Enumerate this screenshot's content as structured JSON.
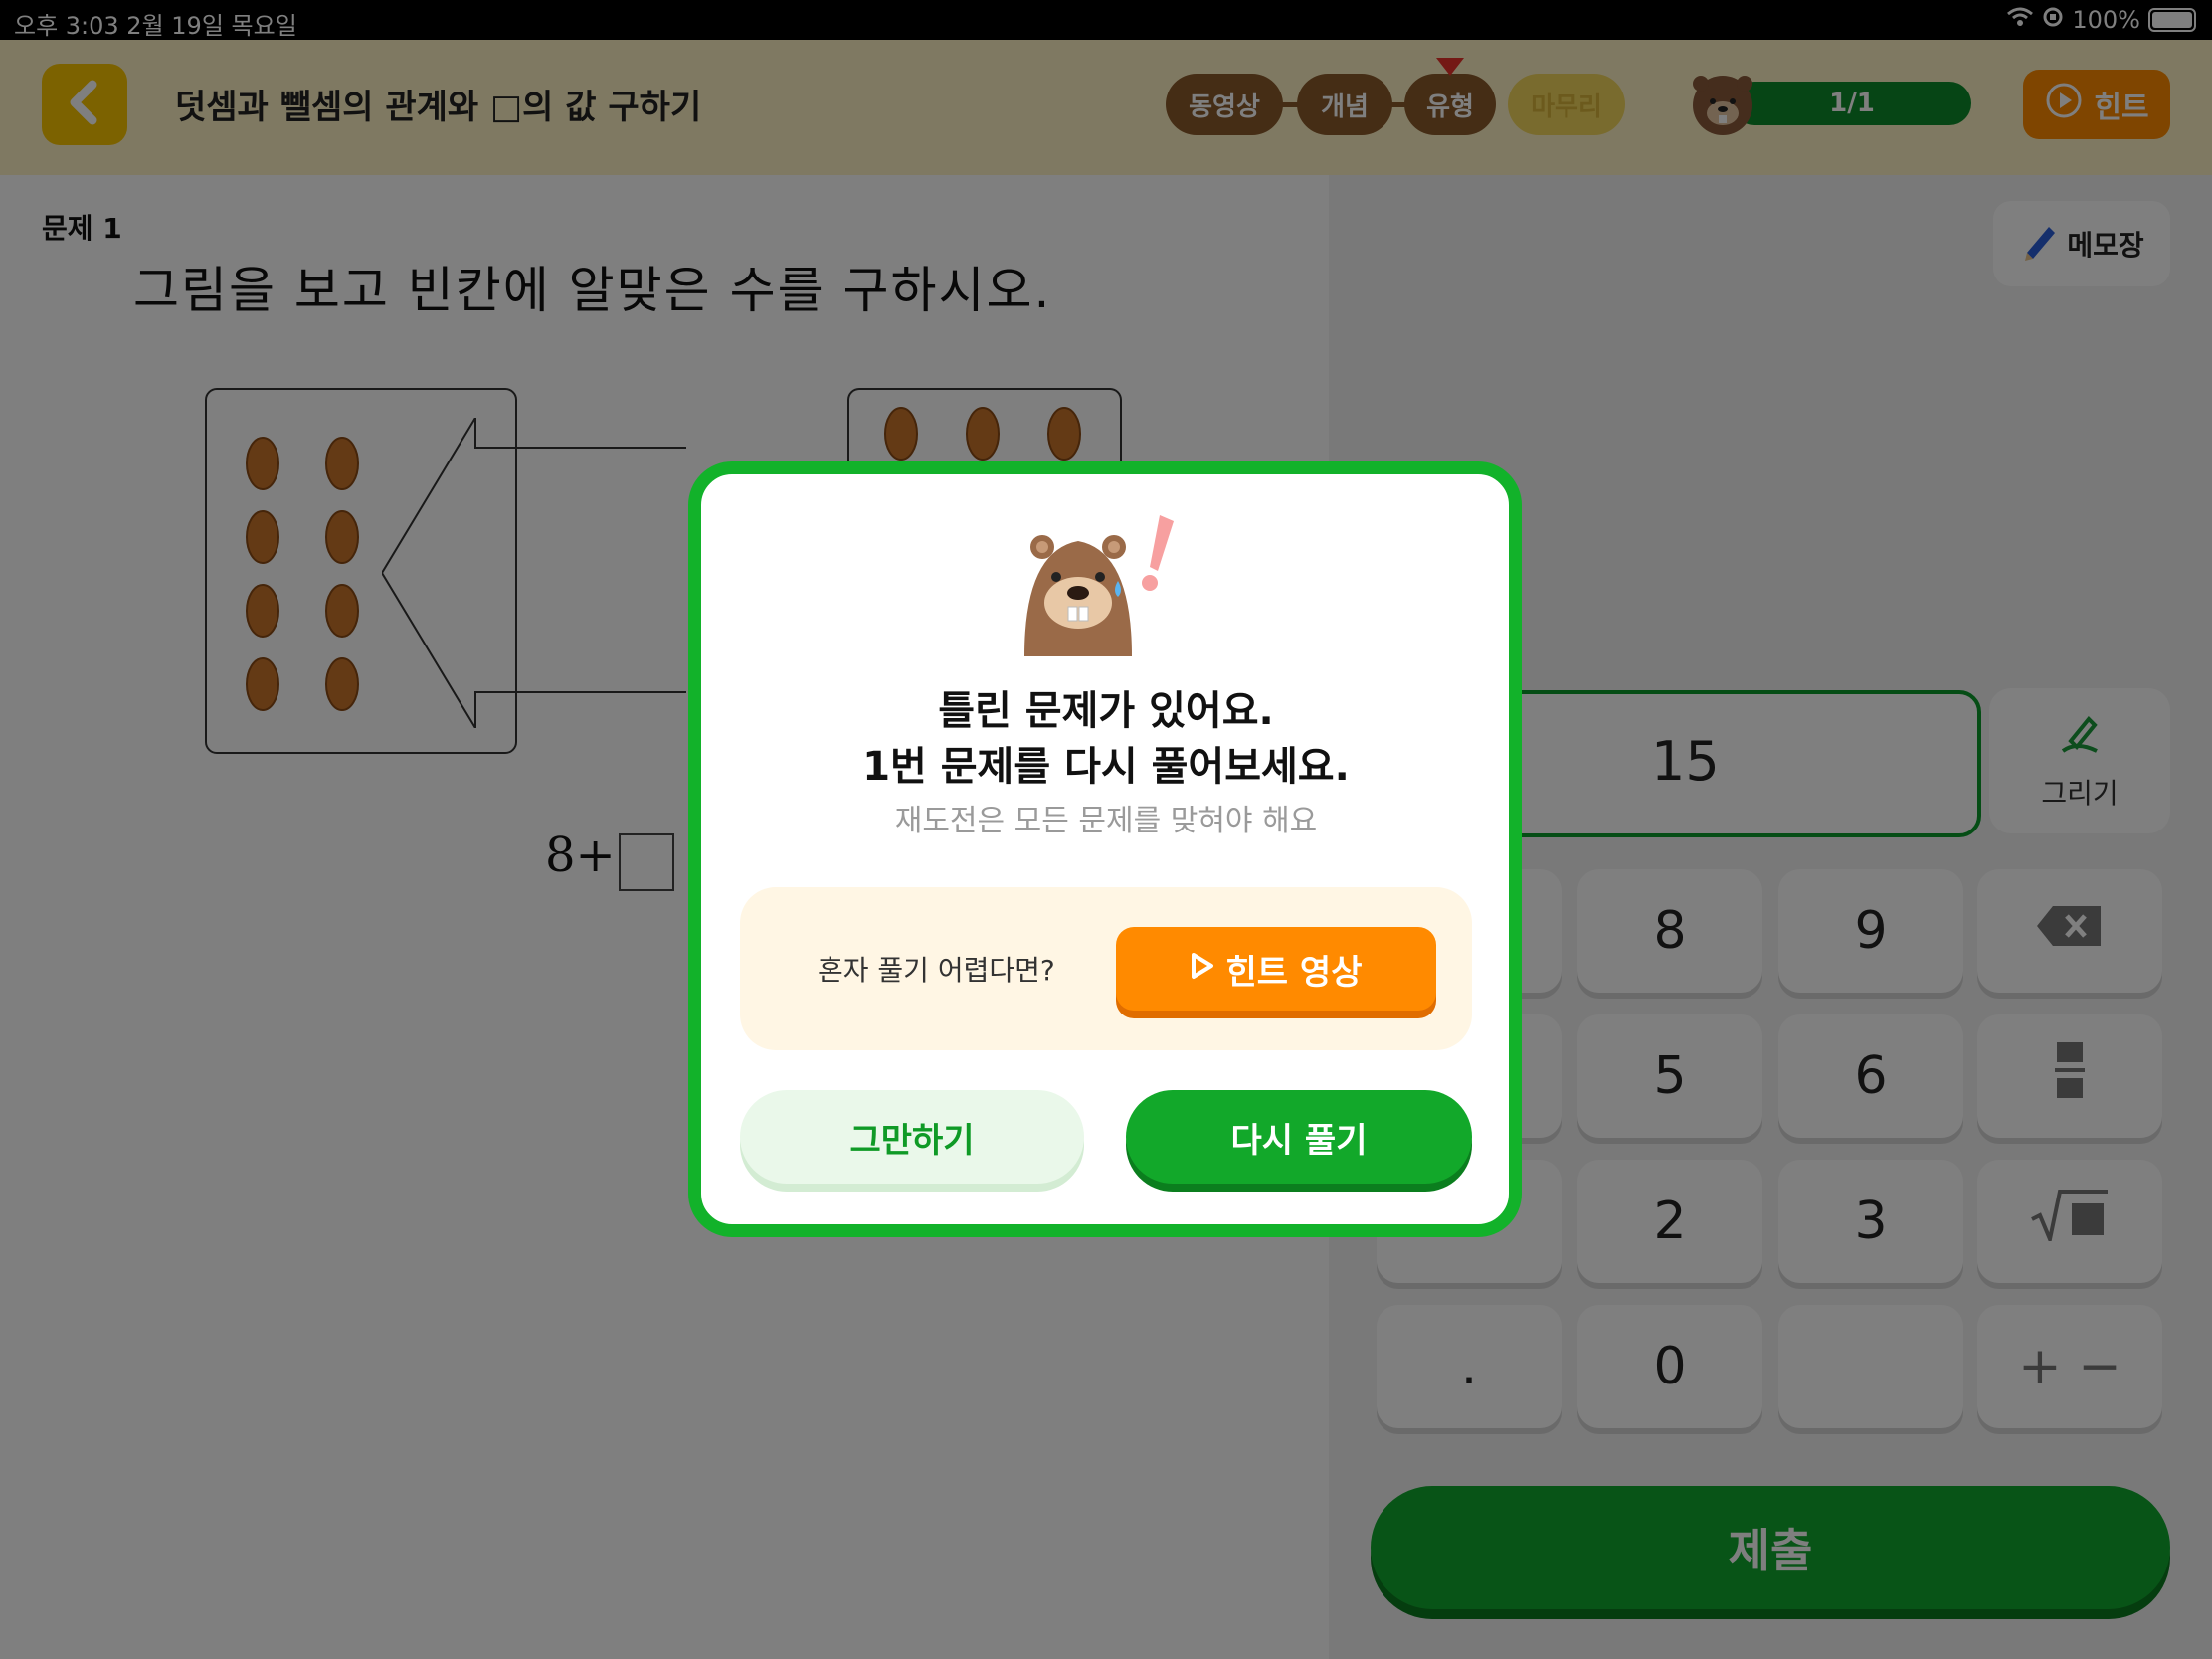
{
  "status_bar": {
    "time_date": "오후 3:03   2월 19일 목요일",
    "battery": "100%"
  },
  "header": {
    "title": "덧셈과 뺄셈의 관계와 □의 값 구하기",
    "steps": [
      "동영상",
      "개념",
      "유형",
      "마무리"
    ],
    "progress": "1/1",
    "hint_label": "힌트"
  },
  "problem": {
    "number_label": "문제 1",
    "instruction": "그림을 보고 빈칸에 알맞은 수를 구하시오.",
    "equation_prefix": "8+"
  },
  "right_pane": {
    "memo_label": "메모장",
    "answer_value": "15",
    "draw_label": "그리기",
    "keys": [
      "8",
      "9",
      "5",
      "6",
      "2",
      "3",
      ".",
      "0",
      "+ −"
    ],
    "submit_label": "제출"
  },
  "modal": {
    "title_line1": "틀린 문제가 있어요.",
    "title_line2": "1번 문제를 다시 풀어보세요.",
    "subtitle": "재도전은 모든 문제를 맞혀야 해요",
    "hint_question": "혼자 풀기 어렵다면?",
    "hint_video_label": "힌트 영상",
    "quit_label": "그만하기",
    "retry_label": "다시 풀기"
  },
  "colors": {
    "primary_green": "#12b22a",
    "hint_orange": "#ff8a00",
    "header_yellow": "#fff2c4",
    "back_yellow": "#f9c500",
    "step_brown": "#8a5a2b"
  }
}
